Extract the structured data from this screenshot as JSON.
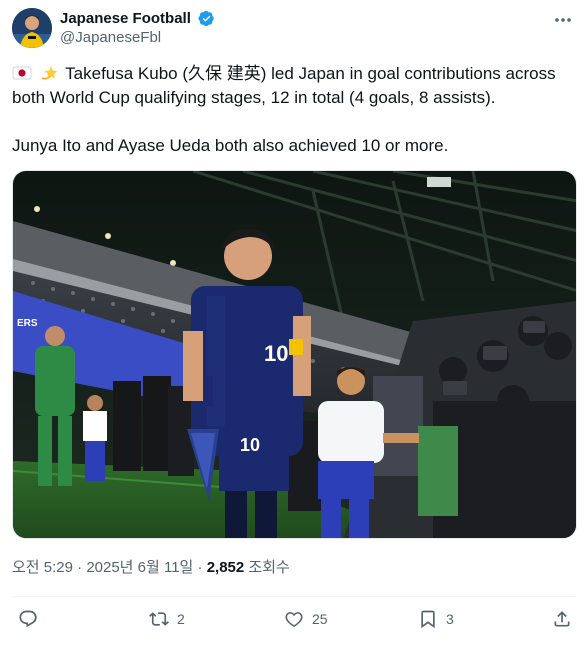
{
  "author": {
    "display_name": "Japanese Football",
    "handle": "@JapaneseFbl",
    "verified_color": "#1d9bf0"
  },
  "tweet": {
    "emojis": [
      "japan-flag",
      "dizzy-star"
    ],
    "line1": "Takefusa Kubo (久保 建英) led Japan in goal contributions across both World Cup qualifying stages, 12 in total (4 goals, 8 assists).",
    "line2": "Junya Ito and Ayase Ueda both also achieved 10 or more."
  },
  "media": {
    "description_icon": "photo"
  },
  "meta": {
    "time": "오전 5:29",
    "separator": "·",
    "date": "2025년 6월 11일",
    "views_count": "2,852",
    "views_label": "조회수"
  },
  "actions": {
    "reply": "",
    "retweet": "2",
    "like": "25",
    "bookmark": "3",
    "share": ""
  },
  "colors": {
    "text_primary": "#0f1419",
    "text_secondary": "#536471",
    "accent": "#1d9bf0"
  }
}
